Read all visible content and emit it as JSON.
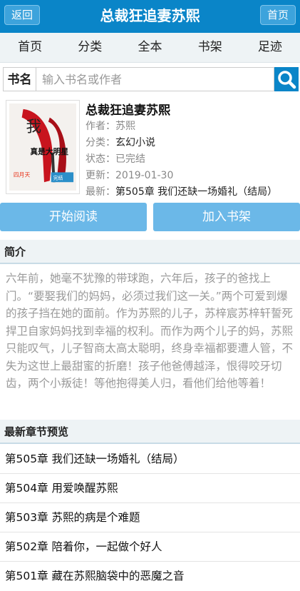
{
  "header": {
    "back_label": "返回",
    "title": "总裁狂追妻苏熙",
    "home_label": "首页"
  },
  "nav": [
    "首页",
    "分类",
    "全本",
    "书架",
    "足迹"
  ],
  "search": {
    "label": "书名",
    "placeholder": "输入书名或作者",
    "icon": "search-icon"
  },
  "book": {
    "title": "总裁狂追妻苏熙",
    "author_label": "作者：",
    "author": "苏熙",
    "category_label": "分类：",
    "category": "玄幻小说",
    "status_label": "状态：",
    "status": "已完结",
    "updated_label": "更新：",
    "updated": "2019-01-30",
    "latest_label": "最新：",
    "latest": "第505章 我们还缺一场婚礼（结局）",
    "cover_text": {
      "top": "我",
      "middle": "真是大明星"
    }
  },
  "actions": {
    "read_label": "开始阅读",
    "shelf_label": "加入书架"
  },
  "intro": {
    "heading": "简介",
    "text": "六年前，她毫不犹豫的带球跑，六年后，孩子的爸找上门。“要娶我们的妈妈，必须过我们这一关。”两个可爱到爆的孩子挡在她的面前。作为苏熙的儿子，苏梓宸苏梓轩誓死捍卫自家妈妈找到幸福的权利。而作为两个儿子的妈，苏熙只能叹气，儿子智商太高太聪明，终身幸福都要遭人管，不失为这世上最甜蜜的折磨！孩子他爸傅越泽，恨得咬牙切齿，两个小叛徒！等他抱得美人归，看他们给他等着！"
  },
  "chapters": {
    "heading": "最新章节预览",
    "items": [
      "第505章 我们还缺一场婚礼（结局）",
      "第504章 用爱唤醒苏熙",
      "第503章 苏熙的病是个难题",
      "第502章 陪着你，一起做个好人",
      "第501章 藏在苏熙脑袋中的恶魔之音"
    ]
  },
  "colors": {
    "primary": "#0a85c8",
    "button": "#6bb8e8",
    "nav_bg": "#eef3f5"
  }
}
